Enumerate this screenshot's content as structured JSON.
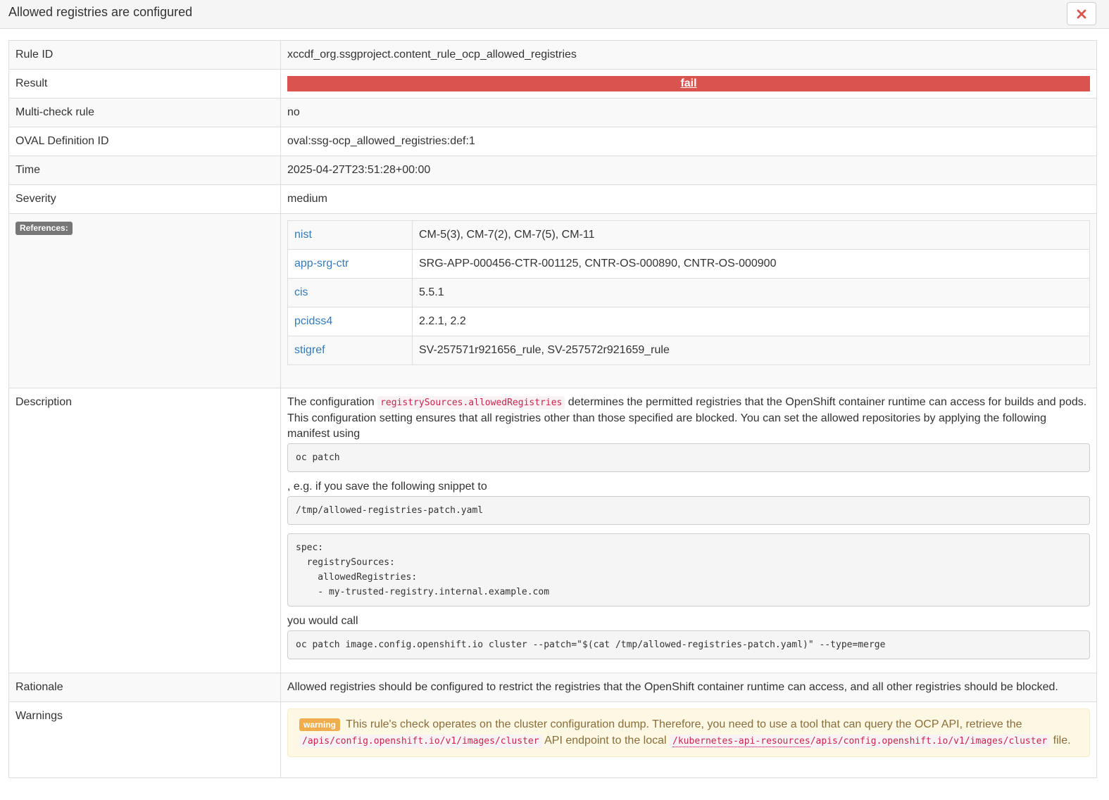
{
  "header": {
    "title": "Allowed registries are configured",
    "close_icon": "close-icon"
  },
  "rows": {
    "rule_id": {
      "label": "Rule ID",
      "value": "xccdf_org.ssgproject.content_rule_ocp_allowed_registries"
    },
    "result": {
      "label": "Result",
      "value": "fail",
      "color": "#d9534f"
    },
    "multi_check": {
      "label": "Multi-check rule",
      "value": "no"
    },
    "oval_id": {
      "label": "OVAL Definition ID",
      "value": "oval:ssg-ocp_allowed_registries:def:1"
    },
    "time": {
      "label": "Time",
      "value": "2025-04-27T23:51:28+00:00"
    },
    "severity": {
      "label": "Severity",
      "value": "medium"
    }
  },
  "references": {
    "label": "References:",
    "items": [
      {
        "key": "nist",
        "value": "CM-5(3), CM-7(2), CM-7(5), CM-11"
      },
      {
        "key": "app-srg-ctr",
        "value": "SRG-APP-000456-CTR-001125, CNTR-OS-000890, CNTR-OS-000900"
      },
      {
        "key": "cis",
        "value": "5.5.1"
      },
      {
        "key": "pcidss4",
        "value": "2.2.1, 2.2"
      },
      {
        "key": "stigref",
        "value": "SV-257571r921656_rule, SV-257572r921659_rule"
      }
    ]
  },
  "description": {
    "label": "Description",
    "text1": "The configuration ",
    "code1": "registrySources.allowedRegistries",
    "text2": " determines the permitted registries that the OpenShift container runtime can access for builds and pods. This configuration setting ensures that all registries other than those specified are blocked. You can set the allowed repositories by applying the following manifest using",
    "pre1": "oc patch",
    "text3": ", e.g. if you save the following snippet to",
    "pre2": "/tmp/allowed-registries-patch.yaml",
    "pre3": "spec:\n  registrySources:\n    allowedRegistries:\n    - my-trusted-registry.internal.example.com",
    "text4": "you would call",
    "pre4": "oc patch image.config.openshift.io cluster --patch=\"$(cat /tmp/allowed-registries-patch.yaml)\" --type=merge"
  },
  "rationale": {
    "label": "Rationale",
    "text": "Allowed registries should be configured to restrict the registries that the OpenShift container runtime can access, and all other registries should be blocked."
  },
  "warnings": {
    "label": "Warnings",
    "badge": "warning",
    "text1": "This rule's check operates on the cluster configuration dump. Therefore, you need to use a tool that can query the OCP API, retrieve the",
    "code1": "/apis/config.openshift.io/v1/images/cluster",
    "text2": " API endpoint to the local ",
    "code2a": "/kubernetes-api-resources",
    "code2b": "/apis/config.openshift.io/v1/images/cluster",
    "text3": " file."
  }
}
